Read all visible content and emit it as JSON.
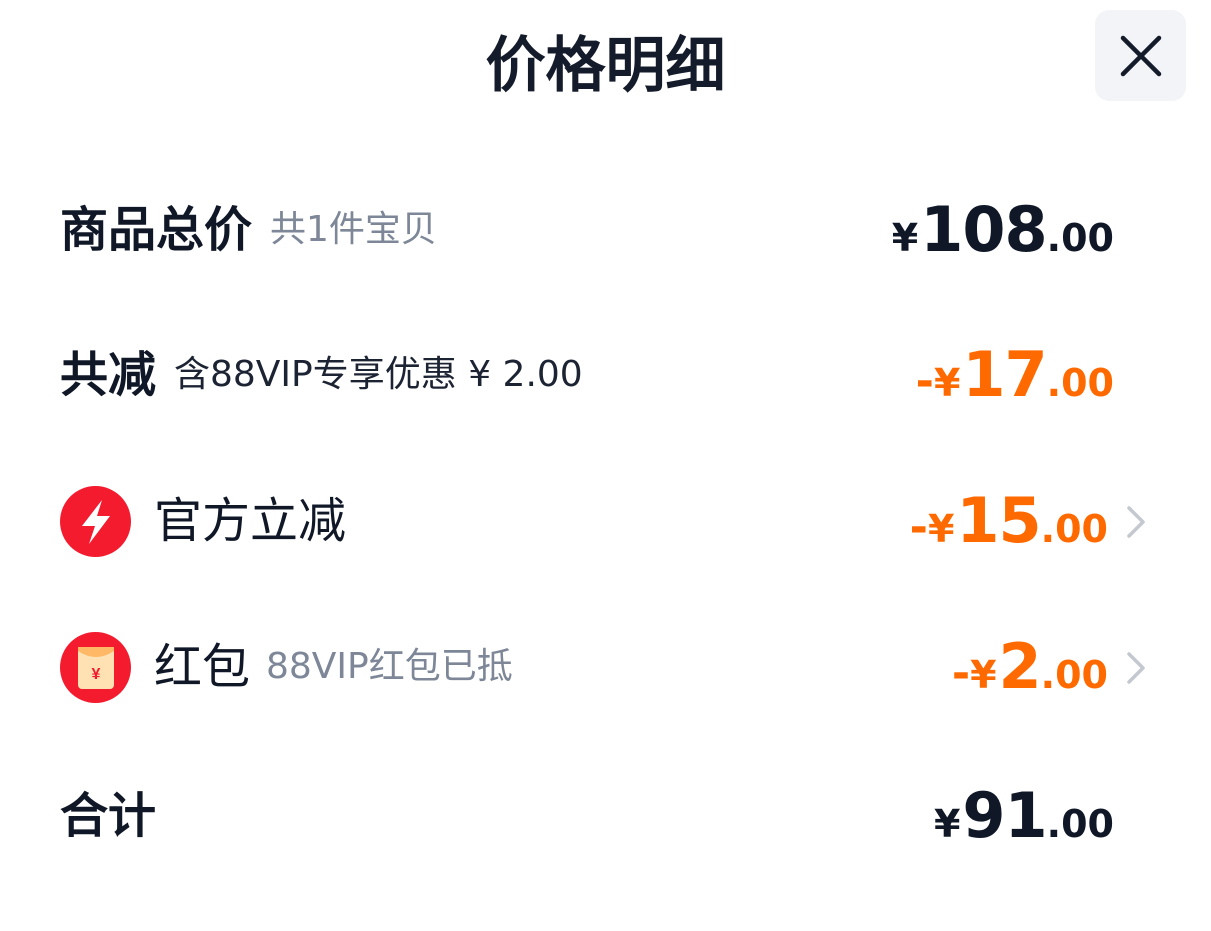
{
  "header": {
    "title": "价格明细",
    "close_icon": "close-icon"
  },
  "rows": {
    "total": {
      "label": "商品总价",
      "note": "共1件宝贝",
      "yen": "¥",
      "int": "108",
      "dec": ".00",
      "color": "#101828"
    },
    "discount": {
      "label": "共减",
      "note": "含88VIP专享优惠 ¥ 2.00",
      "minus": "-",
      "yen": "¥",
      "int": "17",
      "dec": ".00",
      "color": "#ff6a00"
    },
    "official": {
      "icon": "lightning-bolt-icon",
      "label": "官方立减",
      "minus": "-",
      "yen": "¥",
      "int": "15",
      "dec": ".00",
      "color": "#ff6a00",
      "arrow_icon": "chevron-right-icon"
    },
    "redpacket": {
      "icon": "red-envelope-icon",
      "label": "红包",
      "note": "88VIP红包已抵",
      "minus": "-",
      "yen": "¥",
      "int": "2",
      "dec": ".00",
      "color": "#ff6a00",
      "arrow_icon": "chevron-right-icon",
      "envelope_symbol": "¥"
    },
    "sum": {
      "label": "合计",
      "yen": "¥",
      "int": "91",
      "dec": ".00",
      "color": "#101828"
    }
  },
  "colors": {
    "accent_orange": "#ff6a00",
    "badge_red": "#f41b2f",
    "text_dark": "#101828",
    "text_grey": "#7d8797",
    "close_bg": "#f2f4f7"
  }
}
